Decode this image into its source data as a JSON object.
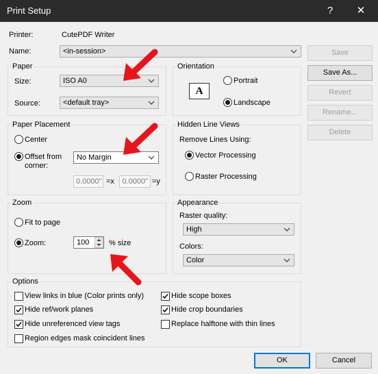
{
  "window": {
    "title": "Print Setup",
    "help_label": "?",
    "close_label": "✕"
  },
  "printer": {
    "label": "Printer:",
    "value": "CutePDF Writer"
  },
  "name": {
    "label": "Name:",
    "value": "<in-session>"
  },
  "paper": {
    "title": "Paper",
    "size_label": "Size:",
    "size_value": "ISO A0",
    "source_label": "Source:",
    "source_value": "<default tray>"
  },
  "orientation": {
    "title": "Orientation",
    "icon_letter": "A",
    "portrait": "Portrait",
    "landscape": "Landscape"
  },
  "placement": {
    "title": "Paper Placement",
    "center": "Center",
    "offset_line1": "Offset from",
    "offset_line2": "corner:",
    "margin_value": "No Margin",
    "x_value": "0.0000\"",
    "x_label": "=x",
    "y_value": "0.0000\"",
    "y_label": "=y"
  },
  "hidden_lines": {
    "title": "Hidden Line Views",
    "remove_label": "Remove Lines Using:",
    "vector": "Vector Processing",
    "raster": "Raster Processing"
  },
  "zoom": {
    "title": "Zoom",
    "fit": "Fit to page",
    "zoom_label": "Zoom:",
    "zoom_value": "100",
    "size_label": "% size"
  },
  "appearance": {
    "title": "Appearance",
    "raster_label": "Raster quality:",
    "raster_value": "High",
    "colors_label": "Colors:",
    "colors_value": "Color"
  },
  "options": {
    "title": "Options",
    "blue_links": "View links in blue (Color prints only)",
    "hide_ref": "Hide ref/work planes",
    "hide_unref": "Hide unreferenced view tags",
    "region_edges": "Region edges mask coincident lines",
    "hide_scope": "Hide scope boxes",
    "hide_crop": "Hide crop boundaries",
    "replace_halftone": "Replace halftone with thin lines"
  },
  "buttons": {
    "save": "Save",
    "save_as": "Save As...",
    "revert": "Revert",
    "rename": "Rename...",
    "delete": "Delete",
    "ok": "OK",
    "cancel": "Cancel"
  },
  "colors": {
    "annotation_arrow": "#e8141b",
    "title_bar": "#2b2b2b",
    "accent": "#0078d7"
  }
}
